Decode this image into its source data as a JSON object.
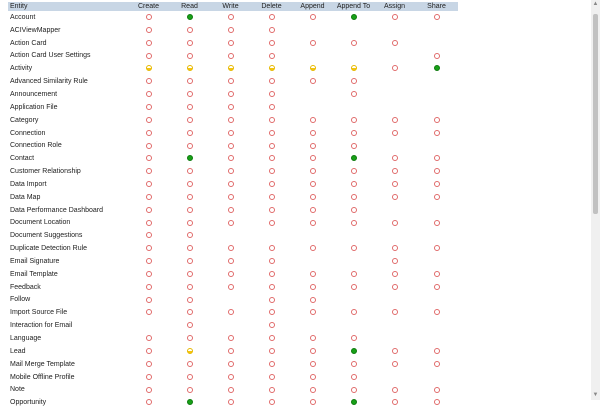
{
  "columns": [
    "Entity",
    "Create",
    "Read",
    "Write",
    "Delete",
    "Append",
    "Append To",
    "Assign",
    "Share"
  ],
  "legend_colors": {
    "none": "#e06a6a",
    "user": "#f4c40f",
    "organization": "#18a018"
  },
  "rows": [
    {
      "name": "Account",
      "p": [
        "none",
        "org",
        "none",
        "none",
        "none",
        "org",
        "none",
        "none"
      ]
    },
    {
      "name": "ACIViewMapper",
      "p": [
        "none",
        "none",
        "none",
        "none",
        "",
        "",
        "",
        ""
      ]
    },
    {
      "name": "Action Card",
      "p": [
        "none",
        "none",
        "none",
        "none",
        "none",
        "none",
        "none",
        ""
      ]
    },
    {
      "name": "Action Card User Settings",
      "p": [
        "none",
        "none",
        "none",
        "none",
        "",
        "",
        "",
        "none"
      ]
    },
    {
      "name": "Activity",
      "p": [
        "user",
        "user",
        "user",
        "user",
        "user",
        "user",
        "none",
        "org"
      ]
    },
    {
      "name": "Advanced Similarity Rule",
      "p": [
        "none",
        "none",
        "none",
        "none",
        "none",
        "none",
        "",
        ""
      ]
    },
    {
      "name": "Announcement",
      "p": [
        "none",
        "none",
        "none",
        "none",
        "",
        "none",
        "",
        ""
      ]
    },
    {
      "name": "Application File",
      "p": [
        "none",
        "none",
        "none",
        "none",
        "",
        "",
        "",
        ""
      ]
    },
    {
      "name": "Category",
      "p": [
        "none",
        "none",
        "none",
        "none",
        "none",
        "none",
        "none",
        "none"
      ]
    },
    {
      "name": "Connection",
      "p": [
        "none",
        "none",
        "none",
        "none",
        "none",
        "none",
        "none",
        "none"
      ]
    },
    {
      "name": "Connection Role",
      "p": [
        "none",
        "none",
        "none",
        "none",
        "none",
        "none",
        "",
        ""
      ]
    },
    {
      "name": "Contact",
      "p": [
        "none",
        "org",
        "none",
        "none",
        "none",
        "org",
        "none",
        "none"
      ]
    },
    {
      "name": "Customer Relationship",
      "p": [
        "none",
        "none",
        "none",
        "none",
        "none",
        "none",
        "none",
        "none"
      ]
    },
    {
      "name": "Data Import",
      "p": [
        "none",
        "none",
        "none",
        "none",
        "none",
        "none",
        "none",
        "none"
      ]
    },
    {
      "name": "Data Map",
      "p": [
        "none",
        "none",
        "none",
        "none",
        "none",
        "none",
        "none",
        "none"
      ]
    },
    {
      "name": "Data Performance Dashboard",
      "p": [
        "none",
        "none",
        "none",
        "none",
        "none",
        "none",
        "",
        ""
      ]
    },
    {
      "name": "Document Location",
      "p": [
        "none",
        "none",
        "none",
        "none",
        "none",
        "none",
        "none",
        "none"
      ]
    },
    {
      "name": "Document Suggestions",
      "p": [
        "none",
        "none",
        "",
        "",
        "",
        "",
        "",
        ""
      ]
    },
    {
      "name": "Duplicate Detection Rule",
      "p": [
        "none",
        "none",
        "none",
        "none",
        "none",
        "none",
        "none",
        "none"
      ]
    },
    {
      "name": "Email Signature",
      "p": [
        "none",
        "none",
        "none",
        "none",
        "",
        "",
        "none",
        ""
      ]
    },
    {
      "name": "Email Template",
      "p": [
        "none",
        "none",
        "none",
        "none",
        "none",
        "none",
        "none",
        "none"
      ]
    },
    {
      "name": "Feedback",
      "p": [
        "none",
        "none",
        "none",
        "none",
        "none",
        "none",
        "none",
        "none"
      ]
    },
    {
      "name": "Follow",
      "p": [
        "none",
        "none",
        "",
        "none",
        "none",
        "",
        "",
        ""
      ]
    },
    {
      "name": "Import Source File",
      "p": [
        "none",
        "none",
        "none",
        "none",
        "none",
        "none",
        "none",
        "none"
      ]
    },
    {
      "name": "Interaction for Email",
      "p": [
        "",
        "none",
        "",
        "none",
        "",
        "",
        "",
        ""
      ]
    },
    {
      "name": "Language",
      "p": [
        "none",
        "none",
        "none",
        "none",
        "none",
        "none",
        "",
        ""
      ]
    },
    {
      "name": "Lead",
      "p": [
        "none",
        "user",
        "none",
        "none",
        "none",
        "org",
        "none",
        "none"
      ]
    },
    {
      "name": "Mail Merge Template",
      "p": [
        "none",
        "none",
        "none",
        "none",
        "none",
        "none",
        "none",
        "none"
      ]
    },
    {
      "name": "Mobile Offline Profile",
      "p": [
        "none",
        "none",
        "none",
        "none",
        "none",
        "none",
        "",
        ""
      ]
    },
    {
      "name": "Note",
      "p": [
        "none",
        "none",
        "none",
        "none",
        "none",
        "none",
        "none",
        "none"
      ]
    },
    {
      "name": "Opportunity",
      "p": [
        "none",
        "org",
        "none",
        "none",
        "none",
        "org",
        "none",
        "none"
      ]
    }
  ]
}
